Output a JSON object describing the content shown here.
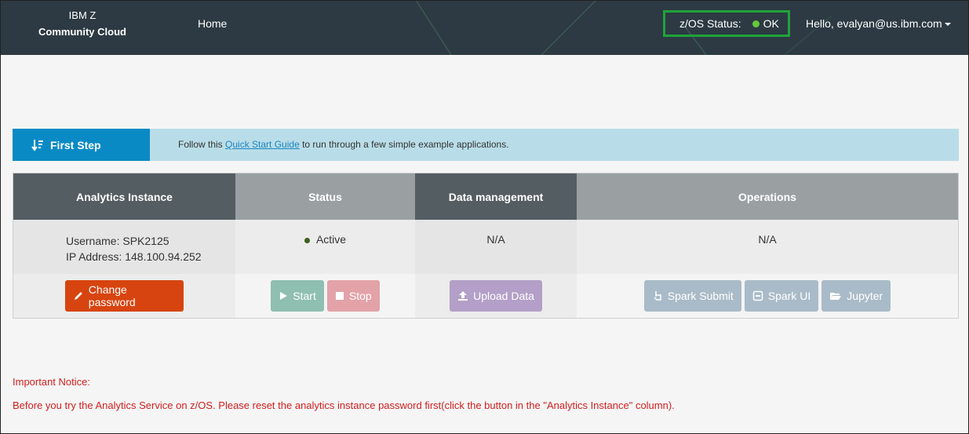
{
  "header": {
    "brand_line1": "IBM Z",
    "brand_line2": "Community Cloud",
    "nav_home": "Home",
    "zos_status_label": "z/OS Status:",
    "zos_status_value": "OK",
    "user_greeting": "Hello, evalyan@us.ibm.com"
  },
  "first_step": {
    "tab_label": "First Step",
    "text_before": "Follow this ",
    "link_text": "Quick Start Guide",
    "text_after": " to run through a few simple example applications."
  },
  "table": {
    "columns": [
      "Analytics Instance",
      "Status",
      "Data management",
      "Operations"
    ],
    "instance": {
      "username": "Username: SPK2125",
      "ip": "IP Address: 148.100.94.252",
      "button": "Change password"
    },
    "status": {
      "value": "Active",
      "start": "Start",
      "stop": "Stop"
    },
    "data_management": {
      "value": "N/A",
      "upload": "Upload Data"
    },
    "operations": {
      "value": "N/A",
      "spark_submit": "Spark Submit",
      "spark_ui": "Spark UI",
      "jupyter": "Jupyter"
    }
  },
  "notice": {
    "title": "Important Notice:",
    "body": "Before you try the Analytics Service on z/OS. Please reset the analytics instance password first(click the button in the \"Analytics Instance\" column)."
  },
  "colors": {
    "header_bg": "#2d3a43",
    "status_ok": "#64c83c",
    "zos_border": "#1fa33a",
    "first_step_tab": "#0a8ac5",
    "first_step_bar": "#b9dde8",
    "change_password_btn": "#d7440f",
    "start_btn": "#8fbfb0",
    "stop_btn": "#e3a2a8",
    "upload_btn": "#b39fc7",
    "ops_btn": "#a9bbc8",
    "notice_text": "#d01f1f"
  }
}
